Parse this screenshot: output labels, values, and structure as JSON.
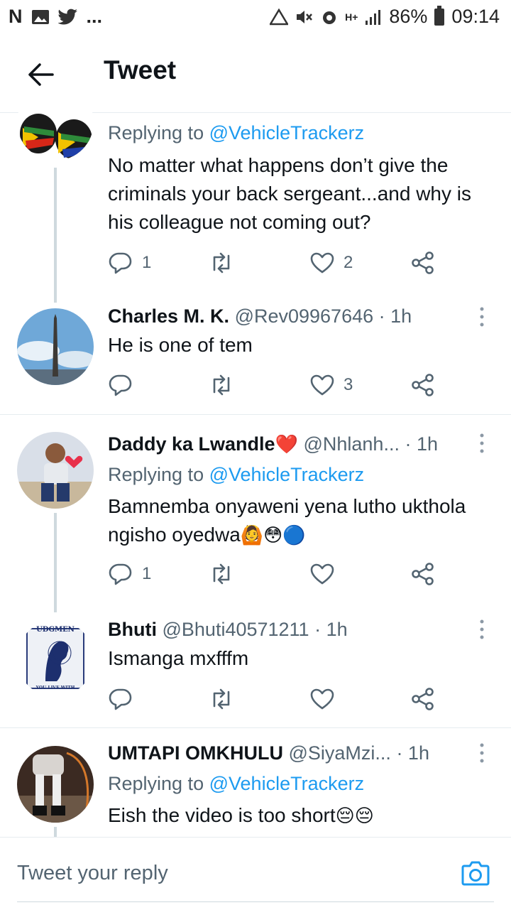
{
  "status_bar": {
    "left_icons": [
      "N",
      "gallery-icon",
      "twitter-icon",
      "..."
    ],
    "battery": "86%",
    "time": "09:14",
    "network": "H+"
  },
  "header": {
    "title": "Tweet"
  },
  "tweets": [
    {
      "replying_label": "Replying to",
      "replying_to": "@VehicleTrackerz",
      "text": "No matter what happens don’t give the criminals your back sergeant...and why is his colleague not coming out?",
      "replies": "1",
      "retweets": "",
      "likes": "2"
    },
    {
      "name": "Charles M. K.",
      "handle": "@Rev09967646",
      "time": "· 1h",
      "text": "He is one of tem",
      "replies": "",
      "retweets": "",
      "likes": "3"
    },
    {
      "name": "Daddy ka Lwandle",
      "name_emoji": "❤️",
      "handle": "@Nhlanh...",
      "time": "· 1h",
      "replying_label": "Replying to",
      "replying_to": "@VehicleTrackerz",
      "text_line1": "Bamnemba onyaweni yena lutho ukthola",
      "text_line2": "ngisho oyedwa",
      "text_emojis": "🙆😳🔵",
      "replies": "1",
      "retweets": "",
      "likes": ""
    },
    {
      "name": "Bhuti",
      "handle": "@Bhuti40571211",
      "time": "· 1h",
      "text": "Ismanga mxfffm",
      "avatar_text_top": "UDGMEN",
      "avatar_text_bottom": "YOU LIVE WITH",
      "replies": "",
      "retweets": "",
      "likes": ""
    },
    {
      "name": "UMTAPI OMKHULU",
      "handle": "@SiyaMzi...",
      "time": "· 1h",
      "replying_label": "Replying to",
      "replying_to": "@VehicleTrackerz",
      "text": "Eish the video is too short",
      "text_emojis": "😔😔"
    }
  ],
  "reply_bar": {
    "placeholder": "Tweet your reply"
  },
  "colors": {
    "accent": "#1d9bf0",
    "secondary_text": "#536471",
    "divider": "#e6ecf0"
  }
}
